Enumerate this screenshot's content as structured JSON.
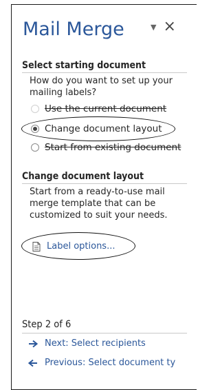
{
  "pane": {
    "title": "Mail Merge",
    "controls": {
      "dropdown_glyph": "▼",
      "close_glyph": "×"
    }
  },
  "select_section": {
    "heading": "Select starting document",
    "prompt": "How do you want to set up your mailing labels?",
    "options": [
      {
        "label": "Use the current document",
        "state": "disabled"
      },
      {
        "label": "Change document layout",
        "state": "checked"
      },
      {
        "label": "Start from existing document",
        "state": "unchecked"
      }
    ]
  },
  "layout_section": {
    "heading": "Change document layout",
    "description": "Start from a ready-to-use mail merge template that can be customized to suit your needs.",
    "link_label": "Label options..."
  },
  "step": {
    "label": "Step 2 of 6",
    "next_label": "Next: Select recipients",
    "previous_label": "Previous: Select document ty"
  },
  "icons": {
    "dropdown": "chevron-down-icon",
    "close": "close-icon",
    "label_options": "document-icon",
    "next": "arrow-right-icon",
    "previous": "arrow-left-icon"
  },
  "colors": {
    "title": "#2b579a",
    "link": "#2b579a",
    "text": "#262626",
    "disabled": "#b8b8b8",
    "rule": "#c9c9c9"
  }
}
